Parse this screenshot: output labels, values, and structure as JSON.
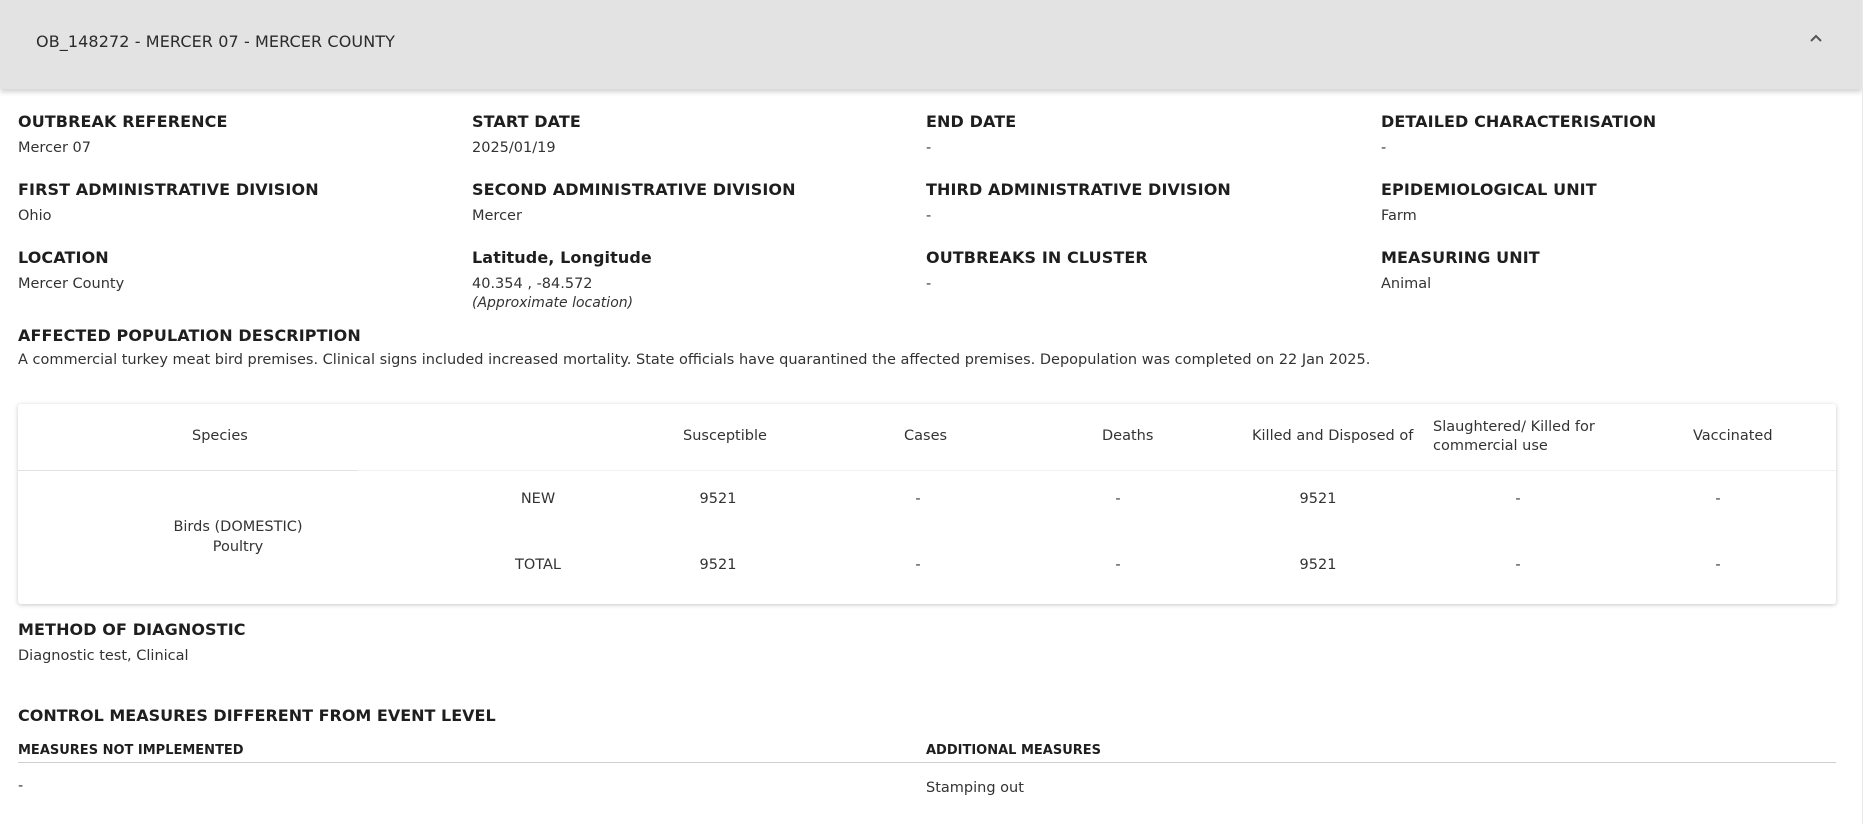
{
  "header": {
    "title": "OB_148272 - MERCER 07 - MERCER COUNTY",
    "collapse_icon": "chevron-up-icon"
  },
  "fields": {
    "outbreak_reference": {
      "label": "Outbreak reference",
      "value": "Mercer 07"
    },
    "start_date": {
      "label": "Start date",
      "value": "2025/01/19"
    },
    "end_date": {
      "label": "End date",
      "value": "-"
    },
    "detailed_characterisation": {
      "label": "Detailed characterisation",
      "value": "-"
    },
    "first_admin_division": {
      "label": "First administrative division",
      "value": "Ohio"
    },
    "second_admin_division": {
      "label": "Second administrative division",
      "value": "Mercer"
    },
    "third_admin_division": {
      "label": "Third administrative division",
      "value": "-"
    },
    "epidemiological_unit": {
      "label": "Epidemiological unit",
      "value": "Farm"
    },
    "location": {
      "label": "Location",
      "value": "Mercer County"
    },
    "lat_long": {
      "label": "Latitude, Longitude",
      "value": "40.354 , -84.572",
      "note": "(Approximate location)"
    },
    "outbreaks_in_cluster": {
      "label": "Outbreaks in cluster",
      "value": "-"
    },
    "measuring_unit": {
      "label": "Measuring unit",
      "value": "Animal"
    },
    "affected_population": {
      "label": "Affected population description",
      "value": "A commercial turkey meat bird premises. Clinical signs included increased mortality. State officials have quarantined the affected premises. Depopulation was completed on 22 Jan 2025."
    }
  },
  "table": {
    "headers": {
      "species": "Species",
      "susceptible": "Susceptible",
      "cases": "Cases",
      "deaths": "Deaths",
      "killed_disposed": "Killed and Disposed of",
      "slaughtered": "Slaughtered/ Killed for commercial use",
      "vaccinated": "Vaccinated"
    },
    "species_line1": "Birds (DOMESTIC)",
    "species_line2": "Poultry",
    "rows": [
      {
        "type": "NEW",
        "susceptible": "9521",
        "cases": "-",
        "deaths": "-",
        "killed_disposed": "9521",
        "slaughtered": "-",
        "vaccinated": "-"
      },
      {
        "type": "TOTAL",
        "susceptible": "9521",
        "cases": "-",
        "deaths": "-",
        "killed_disposed": "9521",
        "slaughtered": "-",
        "vaccinated": "-"
      }
    ]
  },
  "diagnostic": {
    "label": "Method of diagnostic",
    "value": "Diagnostic test, Clinical"
  },
  "control": {
    "title": "Control measures different from event level",
    "not_implemented_label": "Measures not implemented",
    "not_implemented_value": "-",
    "additional_label": "Additional measures",
    "additional_value": "Stamping out"
  }
}
